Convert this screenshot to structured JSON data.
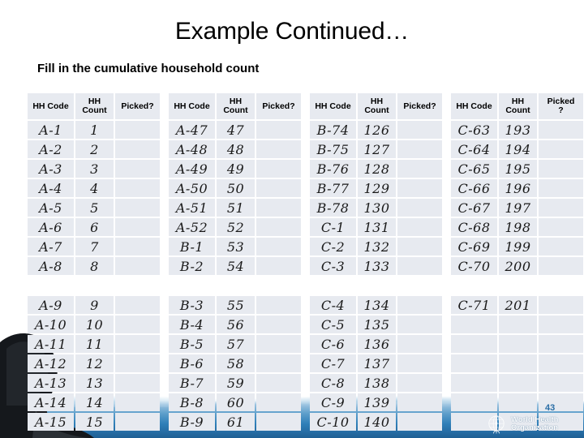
{
  "slide": {
    "title": "Example Continued…",
    "subtitle": "Fill in the cumulative household count",
    "page_number": "43",
    "accent_color": "#2f7fb8",
    "cell_fill_color": "#e7eaf0"
  },
  "footer": {
    "org_line1": "World Health",
    "org_line2": "Organization",
    "emblem_name": "who-emblem-icon"
  },
  "table": {
    "headers": {
      "hh_code": "HH Code",
      "hh_count_line1": "HH",
      "hh_count_line2": "Count",
      "picked": "Picked?",
      "picked_line1": "Picked",
      "picked_line2": "?"
    },
    "groups": [
      {
        "block1": [
          {
            "code": "A-1",
            "count": "1",
            "picked": ""
          },
          {
            "code": "A-2",
            "count": "2",
            "picked": ""
          },
          {
            "code": "A-3",
            "count": "3",
            "picked": ""
          },
          {
            "code": "A-4",
            "count": "4",
            "picked": ""
          },
          {
            "code": "A-5",
            "count": "5",
            "picked": ""
          },
          {
            "code": "A-6",
            "count": "6",
            "picked": ""
          },
          {
            "code": "A-7",
            "count": "7",
            "picked": ""
          },
          {
            "code": "A-8",
            "count": "8",
            "picked": ""
          }
        ],
        "block2": [
          {
            "code": "A-9",
            "count": "9",
            "picked": ""
          },
          {
            "code": "A-10",
            "count": "10",
            "picked": ""
          },
          {
            "code": "A-11",
            "count": "11",
            "picked": ""
          },
          {
            "code": "A-12",
            "count": "12",
            "picked": ""
          },
          {
            "code": "A-13",
            "count": "13",
            "picked": ""
          },
          {
            "code": "A-14",
            "count": "14",
            "picked": ""
          },
          {
            "code": "A-15",
            "count": "15",
            "picked": ""
          }
        ]
      },
      {
        "block1": [
          {
            "code": "A-47",
            "count": "47",
            "picked": ""
          },
          {
            "code": "A-48",
            "count": "48",
            "picked": ""
          },
          {
            "code": "A-49",
            "count": "49",
            "picked": ""
          },
          {
            "code": "A-50",
            "count": "50",
            "picked": ""
          },
          {
            "code": "A-51",
            "count": "51",
            "picked": ""
          },
          {
            "code": "A-52",
            "count": "52",
            "picked": ""
          },
          {
            "code": "B-1",
            "count": "53",
            "picked": ""
          },
          {
            "code": "B-2",
            "count": "54",
            "picked": ""
          }
        ],
        "block2": [
          {
            "code": "B-3",
            "count": "55",
            "picked": ""
          },
          {
            "code": "B-4",
            "count": "56",
            "picked": ""
          },
          {
            "code": "B-5",
            "count": "57",
            "picked": ""
          },
          {
            "code": "B-6",
            "count": "58",
            "picked": ""
          },
          {
            "code": "B-7",
            "count": "59",
            "picked": ""
          },
          {
            "code": "B-8",
            "count": "60",
            "picked": ""
          },
          {
            "code": "B-9",
            "count": "61",
            "picked": ""
          }
        ]
      },
      {
        "block1": [
          {
            "code": "B-74",
            "count": "126",
            "picked": ""
          },
          {
            "code": "B-75",
            "count": "127",
            "picked": ""
          },
          {
            "code": "B-76",
            "count": "128",
            "picked": ""
          },
          {
            "code": "B-77",
            "count": "129",
            "picked": ""
          },
          {
            "code": "B-78",
            "count": "130",
            "picked": ""
          },
          {
            "code": "C-1",
            "count": "131",
            "picked": ""
          },
          {
            "code": "C-2",
            "count": "132",
            "picked": ""
          },
          {
            "code": "C-3",
            "count": "133",
            "picked": ""
          }
        ],
        "block2": [
          {
            "code": "C-4",
            "count": "134",
            "picked": ""
          },
          {
            "code": "C-5",
            "count": "135",
            "picked": ""
          },
          {
            "code": "C-6",
            "count": "136",
            "picked": ""
          },
          {
            "code": "C-7",
            "count": "137",
            "picked": ""
          },
          {
            "code": "C-8",
            "count": "138",
            "picked": ""
          },
          {
            "code": "C-9",
            "count": "139",
            "picked": ""
          },
          {
            "code": "C-10",
            "count": "140",
            "picked": ""
          }
        ]
      },
      {
        "block1": [
          {
            "code": "C-63",
            "count": "193",
            "picked": ""
          },
          {
            "code": "C-64",
            "count": "194",
            "picked": ""
          },
          {
            "code": "C-65",
            "count": "195",
            "picked": ""
          },
          {
            "code": "C-66",
            "count": "196",
            "picked": ""
          },
          {
            "code": "C-67",
            "count": "197",
            "picked": ""
          },
          {
            "code": "C-68",
            "count": "198",
            "picked": ""
          },
          {
            "code": "C-69",
            "count": "199",
            "picked": ""
          },
          {
            "code": "C-70",
            "count": "200",
            "picked": ""
          }
        ],
        "block2": [
          {
            "code": "C-71",
            "count": "201",
            "picked": ""
          },
          {
            "code": "",
            "count": "",
            "picked": ""
          },
          {
            "code": "",
            "count": "",
            "picked": ""
          },
          {
            "code": "",
            "count": "",
            "picked": ""
          },
          {
            "code": "",
            "count": "",
            "picked": ""
          },
          {
            "code": "",
            "count": "",
            "picked": ""
          },
          {
            "code": "",
            "count": "",
            "picked": ""
          }
        ]
      }
    ]
  }
}
